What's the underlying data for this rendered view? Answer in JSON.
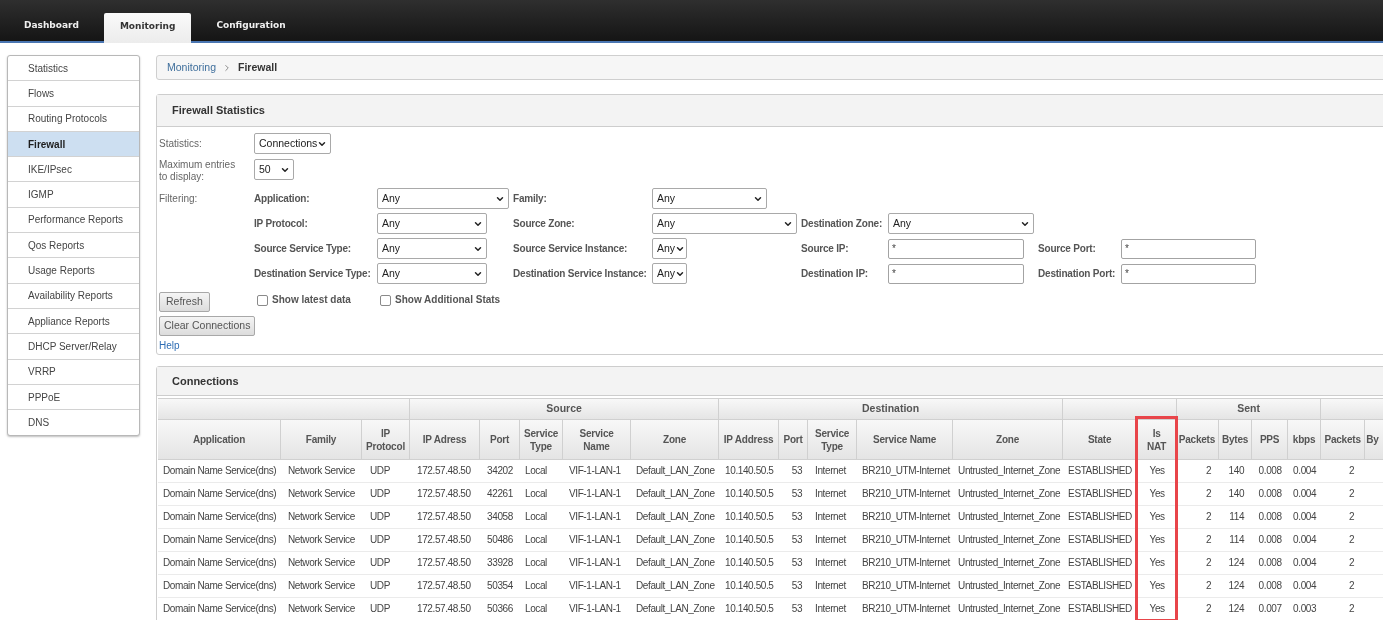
{
  "top_nav": {
    "tabs": [
      {
        "label": "Dashboard",
        "selected": false
      },
      {
        "label": "Monitoring",
        "selected": true
      },
      {
        "label": "Configuration",
        "selected": false
      }
    ]
  },
  "sidebar": {
    "items": [
      {
        "label": "Statistics",
        "selected": false
      },
      {
        "label": "Flows",
        "selected": false
      },
      {
        "label": "Routing Protocols",
        "selected": false
      },
      {
        "label": "Firewall",
        "selected": true
      },
      {
        "label": "IKE/IPsec",
        "selected": false
      },
      {
        "label": "IGMP",
        "selected": false
      },
      {
        "label": "Performance Reports",
        "selected": false
      },
      {
        "label": "Qos Reports",
        "selected": false
      },
      {
        "label": "Usage Reports",
        "selected": false
      },
      {
        "label": "Availability Reports",
        "selected": false
      },
      {
        "label": "Appliance Reports",
        "selected": false
      },
      {
        "label": "DHCP Server/Relay",
        "selected": false
      },
      {
        "label": "VRRP",
        "selected": false
      },
      {
        "label": "PPPoE",
        "selected": false
      },
      {
        "label": "DNS",
        "selected": false
      }
    ]
  },
  "breadcrumb": [
    "Monitoring",
    "Firewall"
  ],
  "firewall_statistics": {
    "title": "Firewall Statistics",
    "statistics": {
      "label": "Statistics:",
      "value": "Connections"
    },
    "max_entries": {
      "label": "Maximum entries to display:",
      "value": "50"
    },
    "filtering_label": "Filtering:",
    "filters": [
      [
        {
          "label": "Application:",
          "kind": "select",
          "value": "Any"
        },
        {
          "label": "Family:",
          "kind": "select",
          "value": "Any"
        }
      ],
      [
        {
          "label": "IP Protocol:",
          "kind": "select",
          "value": "Any"
        },
        {
          "label": "Source Zone:",
          "kind": "select",
          "value": "Any"
        },
        {
          "label": "Destination Zone:",
          "kind": "select",
          "value": "Any"
        }
      ],
      [
        {
          "label": "Source Service Type:",
          "kind": "select",
          "value": "Any"
        },
        {
          "label": "Source Service Instance:",
          "kind": "select",
          "value": "Any"
        },
        {
          "label": "Source IP:",
          "kind": "text",
          "value": "*"
        },
        {
          "label": "Source Port:",
          "kind": "text",
          "value": "*"
        }
      ],
      [
        {
          "label": "Destination Service Type:",
          "kind": "select",
          "value": "Any"
        },
        {
          "label": "Destination Service Instance:",
          "kind": "select",
          "value": "Any"
        },
        {
          "label": "Destination IP:",
          "kind": "text",
          "value": "*"
        },
        {
          "label": "Destination Port:",
          "kind": "text",
          "value": "*"
        }
      ]
    ],
    "buttons": [
      "Refresh",
      "Clear Connections"
    ],
    "checkboxes": [
      {
        "label": "Show latest data",
        "checked": false
      },
      {
        "label": "Show Additional Stats",
        "checked": false
      }
    ],
    "help_link": "Help"
  },
  "connections": {
    "title": "Connections",
    "column_groups": [
      {
        "columns": [
          {
            "label": "Application",
            "highlighted": false
          },
          {
            "label": "Family",
            "highlighted": false
          },
          {
            "label": "IP Protocol",
            "highlighted": false
          }
        ]
      },
      {
        "label": "Source",
        "columns": [
          {
            "label": "IP Adress",
            "highlighted": false
          },
          {
            "label": "Port",
            "highlighted": false
          },
          {
            "label": "Service Type",
            "highlighted": false
          },
          {
            "label": "Service Name",
            "highlighted": false
          },
          {
            "label": "Zone",
            "highlighted": false
          }
        ]
      },
      {
        "label": "Destination",
        "columns": [
          {
            "label": "IP Address",
            "highlighted": false
          },
          {
            "label": "Port",
            "highlighted": false
          },
          {
            "label": "Service Type",
            "highlighted": false
          },
          {
            "label": "Service Name",
            "highlighted": false
          },
          {
            "label": "Zone",
            "highlighted": false
          }
        ]
      },
      {
        "columns": [
          {
            "label": "State",
            "highlighted": false
          },
          {
            "label": "Is NAT",
            "highlighted": true
          }
        ]
      },
      {
        "label": "Sent",
        "columns": [
          {
            "label": "Packets",
            "highlighted": false
          },
          {
            "label": "Bytes",
            "highlighted": false
          },
          {
            "label": "PPS",
            "highlighted": false
          },
          {
            "label": "kbps",
            "highlighted": false
          }
        ]
      },
      {
        "columns": [
          {
            "label": "Packets",
            "highlighted": false
          },
          {
            "label": "By",
            "highlighted": false
          }
        ]
      }
    ],
    "rows": [
      [
        "Domain Name Service(dns)",
        "Network Service",
        "UDP",
        "172.57.48.50",
        "34202",
        "Local",
        "VIF-1-LAN-1",
        "Default_LAN_Zone",
        "10.140.50.5",
        "53",
        "Internet",
        "BR210_UTM-Internet",
        "Untrusted_Internet_Zone",
        "ESTABLISHED",
        "Yes",
        "2",
        "140",
        "0.008",
        "0.004",
        "2"
      ],
      [
        "Domain Name Service(dns)",
        "Network Service",
        "UDP",
        "172.57.48.50",
        "42261",
        "Local",
        "VIF-1-LAN-1",
        "Default_LAN_Zone",
        "10.140.50.5",
        "53",
        "Internet",
        "BR210_UTM-Internet",
        "Untrusted_Internet_Zone",
        "ESTABLISHED",
        "Yes",
        "2",
        "140",
        "0.008",
        "0.004",
        "2"
      ],
      [
        "Domain Name Service(dns)",
        "Network Service",
        "UDP",
        "172.57.48.50",
        "34058",
        "Local",
        "VIF-1-LAN-1",
        "Default_LAN_Zone",
        "10.140.50.5",
        "53",
        "Internet",
        "BR210_UTM-Internet",
        "Untrusted_Internet_Zone",
        "ESTABLISHED",
        "Yes",
        "2",
        "114",
        "0.008",
        "0.004",
        "2"
      ],
      [
        "Domain Name Service(dns)",
        "Network Service",
        "UDP",
        "172.57.48.50",
        "50486",
        "Local",
        "VIF-1-LAN-1",
        "Default_LAN_Zone",
        "10.140.50.5",
        "53",
        "Internet",
        "BR210_UTM-Internet",
        "Untrusted_Internet_Zone",
        "ESTABLISHED",
        "Yes",
        "2",
        "114",
        "0.008",
        "0.004",
        "2"
      ],
      [
        "Domain Name Service(dns)",
        "Network Service",
        "UDP",
        "172.57.48.50",
        "33928",
        "Local",
        "VIF-1-LAN-1",
        "Default_LAN_Zone",
        "10.140.50.5",
        "53",
        "Internet",
        "BR210_UTM-Internet",
        "Untrusted_Internet_Zone",
        "ESTABLISHED",
        "Yes",
        "2",
        "124",
        "0.008",
        "0.004",
        "2"
      ],
      [
        "Domain Name Service(dns)",
        "Network Service",
        "UDP",
        "172.57.48.50",
        "50354",
        "Local",
        "VIF-1-LAN-1",
        "Default_LAN_Zone",
        "10.140.50.5",
        "53",
        "Internet",
        "BR210_UTM-Internet",
        "Untrusted_Internet_Zone",
        "ESTABLISHED",
        "Yes",
        "2",
        "124",
        "0.008",
        "0.004",
        "2"
      ],
      [
        "Domain Name Service(dns)",
        "Network Service",
        "UDP",
        "172.57.48.50",
        "50366",
        "Local",
        "VIF-1-LAN-1",
        "Default_LAN_Zone",
        "10.140.50.5",
        "53",
        "Internet",
        "BR210_UTM-Internet",
        "Untrusted_Internet_Zone",
        "ESTABLISHED",
        "Yes",
        "2",
        "124",
        "0.007",
        "0.003",
        "2"
      ]
    ]
  }
}
